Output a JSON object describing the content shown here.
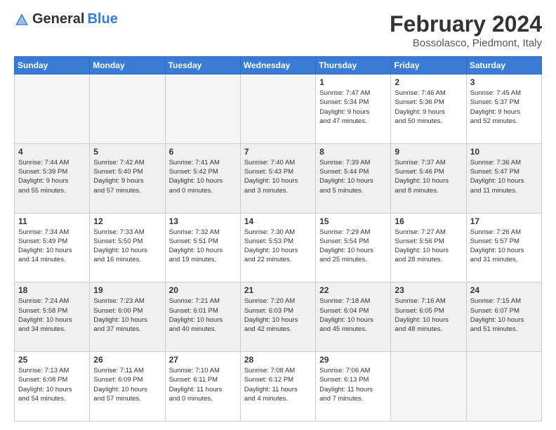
{
  "header": {
    "logo_general": "General",
    "logo_blue": "Blue",
    "month_year": "February 2024",
    "location": "Bossolasco, Piedmont, Italy"
  },
  "days_of_week": [
    "Sunday",
    "Monday",
    "Tuesday",
    "Wednesday",
    "Thursday",
    "Friday",
    "Saturday"
  ],
  "weeks": [
    {
      "shaded": false,
      "days": [
        {
          "number": "",
          "info": "",
          "empty": true
        },
        {
          "number": "",
          "info": "",
          "empty": true
        },
        {
          "number": "",
          "info": "",
          "empty": true
        },
        {
          "number": "",
          "info": "",
          "empty": true
        },
        {
          "number": "1",
          "info": "Sunrise: 7:47 AM\nSunset: 5:34 PM\nDaylight: 9 hours\nand 47 minutes.",
          "empty": false
        },
        {
          "number": "2",
          "info": "Sunrise: 7:46 AM\nSunset: 5:36 PM\nDaylight: 9 hours\nand 50 minutes.",
          "empty": false
        },
        {
          "number": "3",
          "info": "Sunrise: 7:45 AM\nSunset: 5:37 PM\nDaylight: 9 hours\nand 52 minutes.",
          "empty": false
        }
      ]
    },
    {
      "shaded": true,
      "days": [
        {
          "number": "4",
          "info": "Sunrise: 7:44 AM\nSunset: 5:39 PM\nDaylight: 9 hours\nand 55 minutes.",
          "empty": false
        },
        {
          "number": "5",
          "info": "Sunrise: 7:42 AM\nSunset: 5:40 PM\nDaylight: 9 hours\nand 57 minutes.",
          "empty": false
        },
        {
          "number": "6",
          "info": "Sunrise: 7:41 AM\nSunset: 5:42 PM\nDaylight: 10 hours\nand 0 minutes.",
          "empty": false
        },
        {
          "number": "7",
          "info": "Sunrise: 7:40 AM\nSunset: 5:43 PM\nDaylight: 10 hours\nand 3 minutes.",
          "empty": false
        },
        {
          "number": "8",
          "info": "Sunrise: 7:39 AM\nSunset: 5:44 PM\nDaylight: 10 hours\nand 5 minutes.",
          "empty": false
        },
        {
          "number": "9",
          "info": "Sunrise: 7:37 AM\nSunset: 5:46 PM\nDaylight: 10 hours\nand 8 minutes.",
          "empty": false
        },
        {
          "number": "10",
          "info": "Sunrise: 7:36 AM\nSunset: 5:47 PM\nDaylight: 10 hours\nand 11 minutes.",
          "empty": false
        }
      ]
    },
    {
      "shaded": false,
      "days": [
        {
          "number": "11",
          "info": "Sunrise: 7:34 AM\nSunset: 5:49 PM\nDaylight: 10 hours\nand 14 minutes.",
          "empty": false
        },
        {
          "number": "12",
          "info": "Sunrise: 7:33 AM\nSunset: 5:50 PM\nDaylight: 10 hours\nand 16 minutes.",
          "empty": false
        },
        {
          "number": "13",
          "info": "Sunrise: 7:32 AM\nSunset: 5:51 PM\nDaylight: 10 hours\nand 19 minutes.",
          "empty": false
        },
        {
          "number": "14",
          "info": "Sunrise: 7:30 AM\nSunset: 5:53 PM\nDaylight: 10 hours\nand 22 minutes.",
          "empty": false
        },
        {
          "number": "15",
          "info": "Sunrise: 7:29 AM\nSunset: 5:54 PM\nDaylight: 10 hours\nand 25 minutes.",
          "empty": false
        },
        {
          "number": "16",
          "info": "Sunrise: 7:27 AM\nSunset: 5:56 PM\nDaylight: 10 hours\nand 28 minutes.",
          "empty": false
        },
        {
          "number": "17",
          "info": "Sunrise: 7:26 AM\nSunset: 5:57 PM\nDaylight: 10 hours\nand 31 minutes.",
          "empty": false
        }
      ]
    },
    {
      "shaded": true,
      "days": [
        {
          "number": "18",
          "info": "Sunrise: 7:24 AM\nSunset: 5:58 PM\nDaylight: 10 hours\nand 34 minutes.",
          "empty": false
        },
        {
          "number": "19",
          "info": "Sunrise: 7:23 AM\nSunset: 6:00 PM\nDaylight: 10 hours\nand 37 minutes.",
          "empty": false
        },
        {
          "number": "20",
          "info": "Sunrise: 7:21 AM\nSunset: 6:01 PM\nDaylight: 10 hours\nand 40 minutes.",
          "empty": false
        },
        {
          "number": "21",
          "info": "Sunrise: 7:20 AM\nSunset: 6:03 PM\nDaylight: 10 hours\nand 42 minutes.",
          "empty": false
        },
        {
          "number": "22",
          "info": "Sunrise: 7:18 AM\nSunset: 6:04 PM\nDaylight: 10 hours\nand 45 minutes.",
          "empty": false
        },
        {
          "number": "23",
          "info": "Sunrise: 7:16 AM\nSunset: 6:05 PM\nDaylight: 10 hours\nand 48 minutes.",
          "empty": false
        },
        {
          "number": "24",
          "info": "Sunrise: 7:15 AM\nSunset: 6:07 PM\nDaylight: 10 hours\nand 51 minutes.",
          "empty": false
        }
      ]
    },
    {
      "shaded": false,
      "days": [
        {
          "number": "25",
          "info": "Sunrise: 7:13 AM\nSunset: 6:08 PM\nDaylight: 10 hours\nand 54 minutes.",
          "empty": false
        },
        {
          "number": "26",
          "info": "Sunrise: 7:11 AM\nSunset: 6:09 PM\nDaylight: 10 hours\nand 57 minutes.",
          "empty": false
        },
        {
          "number": "27",
          "info": "Sunrise: 7:10 AM\nSunset: 6:11 PM\nDaylight: 11 hours\nand 0 minutes.",
          "empty": false
        },
        {
          "number": "28",
          "info": "Sunrise: 7:08 AM\nSunset: 6:12 PM\nDaylight: 11 hours\nand 4 minutes.",
          "empty": false
        },
        {
          "number": "29",
          "info": "Sunrise: 7:06 AM\nSunset: 6:13 PM\nDaylight: 11 hours\nand 7 minutes.",
          "empty": false
        },
        {
          "number": "",
          "info": "",
          "empty": true
        },
        {
          "number": "",
          "info": "",
          "empty": true
        }
      ]
    }
  ]
}
